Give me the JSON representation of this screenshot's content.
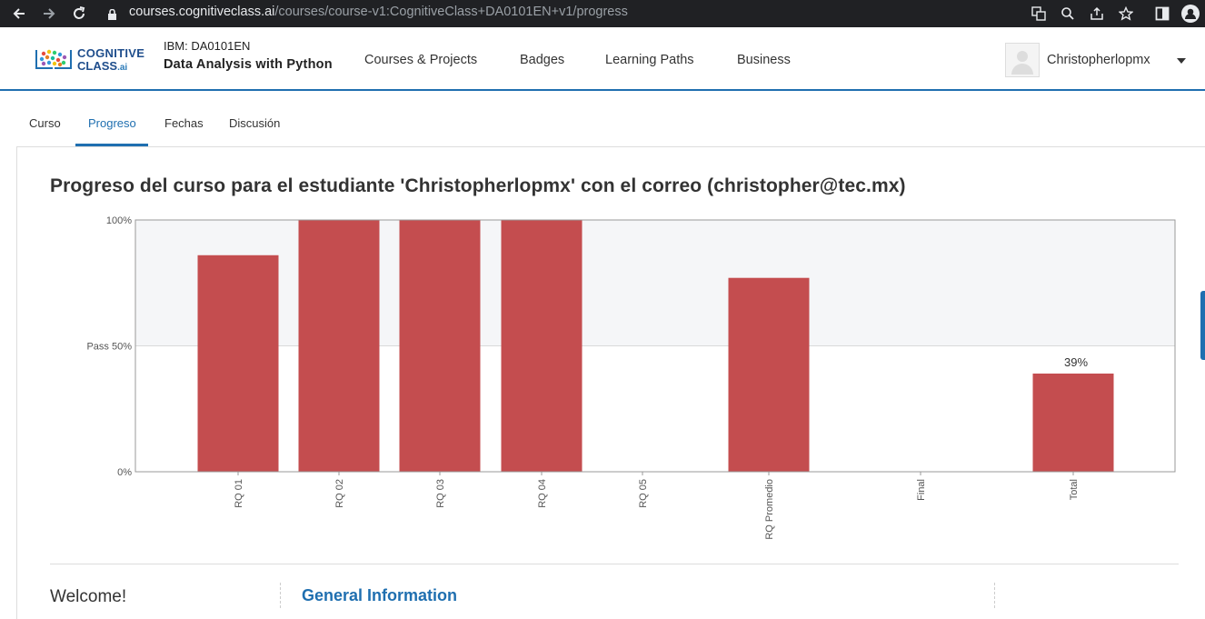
{
  "browser": {
    "url_host": "courses.cognitiveclass.ai",
    "url_path": "/courses/course-v1:CognitiveClass+DA0101EN+v1/progress"
  },
  "header": {
    "logo_line1": "COGNITIVE",
    "logo_line2": "CLASS",
    "logo_suffix": ".ai",
    "course_org": "IBM: DA0101EN",
    "course_name": "Data Analysis with Python",
    "nav": [
      "Courses & Projects",
      "Badges",
      "Learning Paths",
      "Business"
    ],
    "username": "Christopherlopmx"
  },
  "tabs": [
    "Curso",
    "Progreso",
    "Fechas",
    "Discusión"
  ],
  "active_tab": "Progreso",
  "page_title": "Progreso del curso para el estudiante 'Christopherlopmx' con el correo (christopher@tec.mx)",
  "chart_data": {
    "type": "bar",
    "categories": [
      "RQ 01",
      "RQ 02",
      "RQ 03",
      "RQ 04",
      "RQ 05",
      "RQ Promedio",
      "Final",
      "Total"
    ],
    "values": [
      86,
      100,
      100,
      100,
      0,
      77,
      0,
      39
    ],
    "y_ticks": [
      {
        "value": 100,
        "label": "100%"
      },
      {
        "value": 50,
        "label": "Pass 50%"
      },
      {
        "value": 0,
        "label": "0%"
      }
    ],
    "ylim": [
      0,
      100
    ],
    "pass_threshold": 50,
    "data_labels": [
      {
        "category": "Total",
        "label": "39%"
      }
    ],
    "bar_color": "#c44d4f",
    "above_pass_bg": "#f5f6f8"
  },
  "footer": {
    "welcome": "Welcome!",
    "general_info": "General Information"
  },
  "colors": {
    "accent": "#1f6fb0",
    "chrome_bg": "#202124"
  }
}
